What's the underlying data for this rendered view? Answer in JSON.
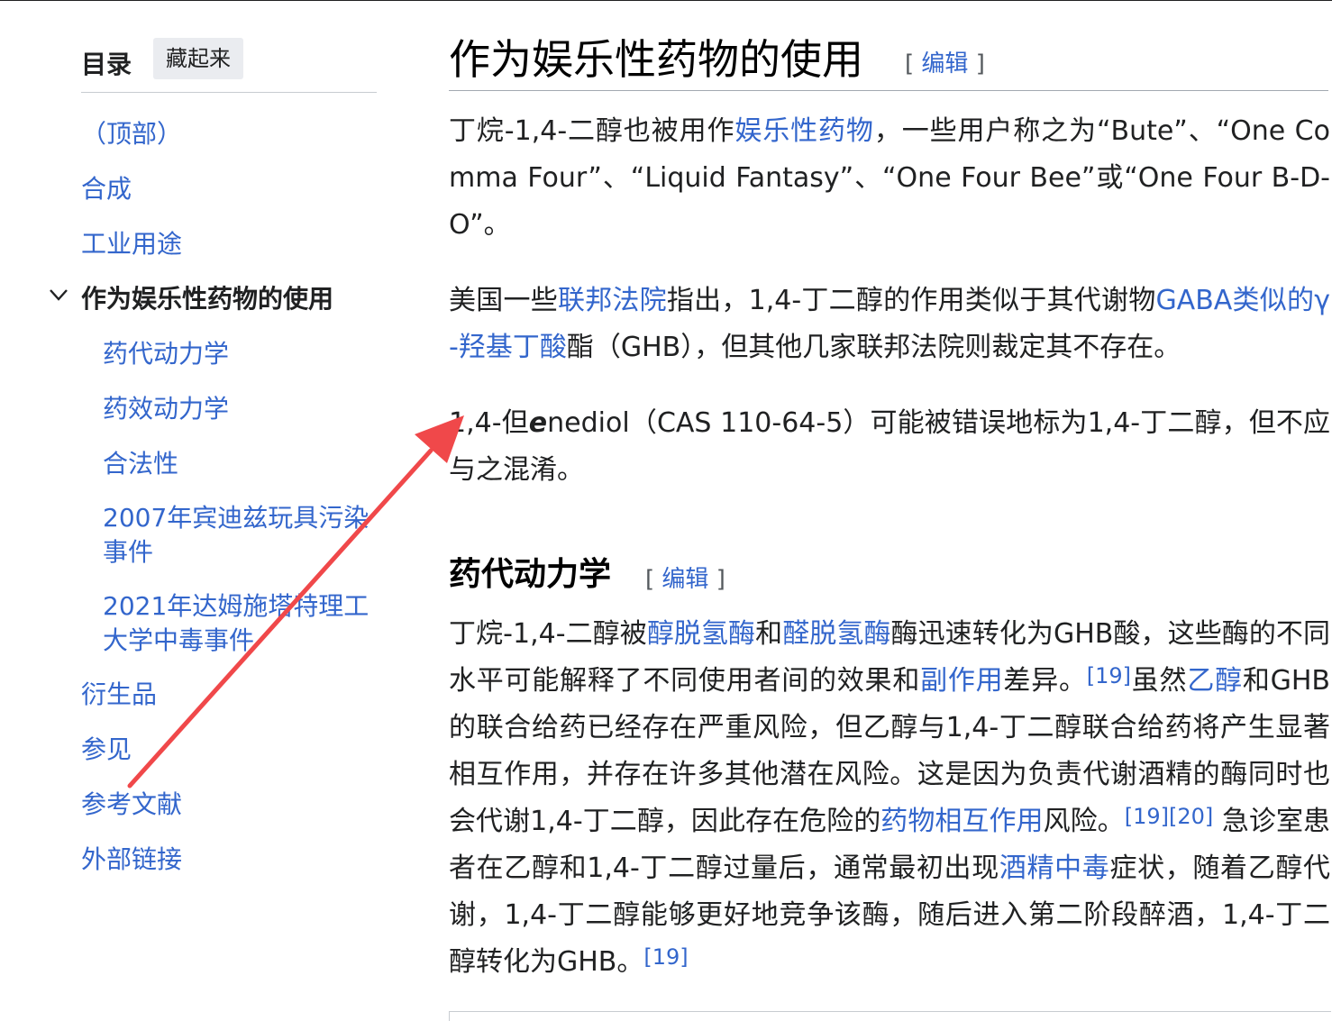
{
  "toc": {
    "title": "目录",
    "hide_button": "藏起来",
    "items": [
      {
        "label": "（顶部）",
        "level": 1
      },
      {
        "label": "合成",
        "level": 1
      },
      {
        "label": "工业用途",
        "level": 1
      },
      {
        "label": "作为娱乐性药物的使用",
        "level": 1,
        "active": true
      },
      {
        "label": "药代动力学",
        "level": 2
      },
      {
        "label": "药效动力学",
        "level": 2
      },
      {
        "label": "合法性",
        "level": 2
      },
      {
        "label": "2007年宾迪兹玩具污染事件",
        "level": 2
      },
      {
        "label": "2021年达姆施塔特理工大学中毒事件",
        "level": 2
      },
      {
        "label": "衍生品",
        "level": 1
      },
      {
        "label": "参见",
        "level": 1
      },
      {
        "label": "参考文献",
        "level": 1
      },
      {
        "label": "外部链接",
        "level": 1
      }
    ]
  },
  "section": {
    "title": "作为娱乐性药物的使用",
    "edit_open": "[ ",
    "edit_label": "编辑",
    "edit_close": " ]"
  },
  "p1": {
    "t1": "丁烷-1,4-二醇也被用作",
    "l1": "娱乐性药物",
    "t2": "，一些用户称之为“Bute”、“One Comma Four”、“Liquid Fantasy”、“One Four Bee”或“One Four B-D-O”。"
  },
  "p2": {
    "t1": "美国一些",
    "l1": "联邦法院",
    "t2": "指出，1,4-丁二醇的作用类似于其代谢物",
    "l2": "GABA类似的γ-羟基丁酸",
    "t3": "酯（GHB），但其他几家联邦法院则裁定其不存在。"
  },
  "p3": {
    "t1": "1,4-但",
    "e": "e",
    "t2": "nediol（CAS 110-64-5）可能被错误地标为1,4-丁二醇，但不应与之混淆。"
  },
  "subsection": {
    "title": "药代动力学",
    "edit_label": "编辑"
  },
  "p4": {
    "t1": "丁烷-1,4-二醇被",
    "l1": "醇脱氢酶",
    "t2": "和",
    "l2": "醛脱氢酶",
    "t3": "酶迅速转化为GHB酸，这些酶的不同水平可能解释了不同使用者间的效果和",
    "l3": "副作用",
    "t4": "差异。",
    "r1": "[19]",
    "t5": "虽然",
    "l4": "乙醇",
    "t6": "和GHB的联合给药已经存在严重风险，但乙醇与1,4-丁二醇联合给药将产生显著相互作用，并存在许多其他潜在风险。这是因为负责代谢酒精的酶同时也会代谢1,4-丁二醇，因此存在危险的",
    "l5": "药物相互作用",
    "t7": "风险。",
    "r2": "[19][20]",
    "t8": " 急诊室患者在乙醇和1,4-丁二醇过量后，通常最初出现",
    "l6": "酒精中毒",
    "t9": "症状，随着乙醇代谢，1,4-丁二醇能够更好地竞争该酶，随后进入第二阶段醉酒，1,4-丁二醇转化为GHB。",
    "r3": "[19]"
  },
  "colors": {
    "link": "#3366cc",
    "text": "#202122",
    "annotation_arrow": "#f0484a"
  }
}
